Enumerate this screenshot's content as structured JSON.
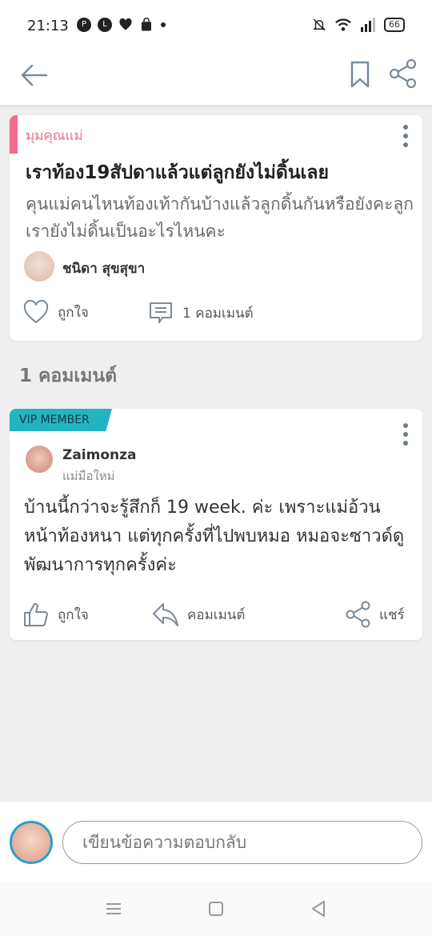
{
  "status_bar": {
    "time": "21:13",
    "battery": "66",
    "left_icons": [
      "pinterest-icon",
      "line-icon",
      "heart-icon",
      "shopping-bag-icon",
      "dot-icon"
    ],
    "right_icons": [
      "mute-bell-icon",
      "wifi-icon",
      "signal-icon",
      "battery-icon"
    ]
  },
  "app_bar": {
    "icons": [
      "back-arrow-icon",
      "bookmark-icon",
      "share-icon"
    ]
  },
  "post": {
    "category": "มุมคุณแม่",
    "title": "เราท้อง19สัปดาแล้วแต่ลูกยังไม่ดิ้นเลย",
    "body": "คุนแม่คนไหนท้องเท้ากันบ้างแล้วลูกดิ้นกันหรือยังคะลูกเรายังไม่ดิ้นเป็นอะไรไหนคะ",
    "author": "ชนิดา สุขสุขา",
    "like_label": "ถูกใจ",
    "comment_label": "1 คอมเมนต์"
  },
  "comments_heading": "1 คอมเมนต์",
  "comment": {
    "badge": "VIP MEMBER",
    "author": "Zaimonza",
    "role": "แม่มือใหม่",
    "text": "บ้านนี้กว่าจะรู้สึกก็ 19 week. ค่ะ เพราะแม่อ้วนหน้าท้องหนา แต่ทุกครั้งที่ไปพบหมอ หมอจะซาวด์ดูพัฒนาการทุกครั้งค่ะ",
    "like_label": "ถูกใจ",
    "comment_label": "คอมเมนต์",
    "share_label": "แชร์"
  },
  "reply": {
    "placeholder": "เขียนข้อความตอบกลับ"
  },
  "colors": {
    "accent_pink": "#f16c8e",
    "vip_teal": "#24b3c3",
    "icon_gray": "#7a8a99"
  }
}
